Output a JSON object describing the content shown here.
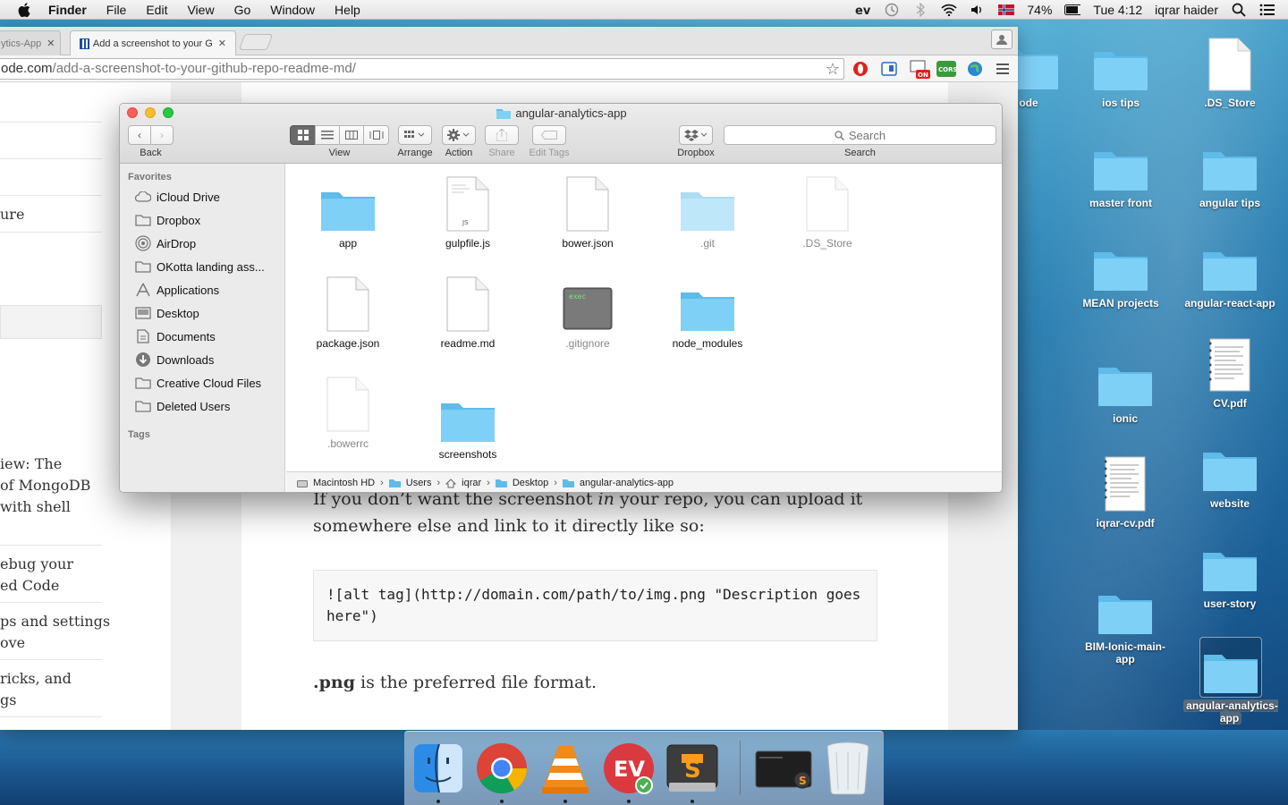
{
  "menubar": {
    "app_name": "Finder",
    "items": [
      "File",
      "Edit",
      "View",
      "Go",
      "Window",
      "Help"
    ],
    "battery": "74%",
    "clock": "Tue 4:12",
    "user": "iqrar haider"
  },
  "browser": {
    "tabs": [
      {
        "label": "ytics-App"
      },
      {
        "label": "Add a screenshot to your G"
      }
    ],
    "url_prefix": "ode.com",
    "url_path": "/add-a-screenshot-to-your-github-repo-readme-md/",
    "ext_cors": "CORS",
    "ext_on": "ON"
  },
  "page": {
    "sidebar_fragments": [
      "ure",
      "iew: The",
      "of MongoDB",
      "with shell",
      "ebug your",
      "ed Code",
      "ps and settings",
      "ove",
      "ricks, and",
      "gs"
    ],
    "para1_line1_a": "If you don’t want the screenshot ",
    "para1_line1_em": "in",
    "para1_line1_b": " your repo, you can upload it",
    "para1_line2": "somewhere else and link to it directly like so:",
    "code_line1": "![alt tag](http://domain.com/path/to/img.png \"Description goes",
    "code_line2": "here\")",
    "para2_bold": ".png",
    "para2_rest": " is the preferred file format."
  },
  "finder": {
    "title": "angular-analytics-app",
    "toolbar": {
      "back": "Back",
      "view": "View",
      "arrange": "Arrange",
      "action": "Action",
      "share": "Share",
      "edit_tags": "Edit Tags",
      "dropbox": "Dropbox",
      "search_placeholder": "Search",
      "search_label": "Search"
    },
    "sidebar": {
      "favorites_heading": "Favorites",
      "tags_heading": "Tags",
      "items": [
        "iCloud Drive",
        "Dropbox",
        "AirDrop",
        "OKotta landing ass...",
        "Applications",
        "Desktop",
        "Documents",
        "Downloads",
        "Creative Cloud Files",
        "Deleted Users"
      ]
    },
    "files": [
      {
        "name": "app"
      },
      {
        "name": "gulpfile.js",
        "badge": "JS"
      },
      {
        "name": "bower.json"
      },
      {
        "name": ".git"
      },
      {
        "name": ".DS_Store"
      },
      {
        "name": "package.json"
      },
      {
        "name": "readme.md"
      },
      {
        "name": ".gitignore",
        "badge": "exec"
      },
      {
        "name": "node_modules"
      },
      {
        "name": ".bowerrc"
      },
      {
        "name": "screenshots"
      }
    ],
    "path": [
      "Macintosh HD",
      "Users",
      "iqrar",
      "Desktop",
      "angular-analytics-app"
    ]
  },
  "desktop": {
    "icons": [
      {
        "label": "ode"
      },
      {
        "label": "ios  tips"
      },
      {
        "label": ".DS_Store"
      },
      {
        "label": "master front"
      },
      {
        "label": "angular tips"
      },
      {
        "label": "MEAN projects"
      },
      {
        "label": "angular-react-app"
      },
      {
        "label": "ionic"
      },
      {
        "label": "CV.pdf"
      },
      {
        "label": "iqrar-cv.pdf"
      },
      {
        "label": "website"
      },
      {
        "label": "user-story"
      },
      {
        "label": "BIM-Ionic-main-app"
      },
      {
        "label": "angular-analytics-app"
      }
    ]
  },
  "dock": {
    "apps": [
      "finder-icon",
      "chrome-icon",
      "vlc-icon",
      "expressvpn-icon",
      "sublime-text-icon",
      "terminal-icon",
      "trash-icon"
    ],
    "sublime_letter": "S",
    "expressvpn_letters": "EV"
  },
  "colors": {
    "folder": "#6ec6f1",
    "finder_toolbar": "#e2e2e2",
    "selected_sidebar": "#dcdcdc"
  }
}
